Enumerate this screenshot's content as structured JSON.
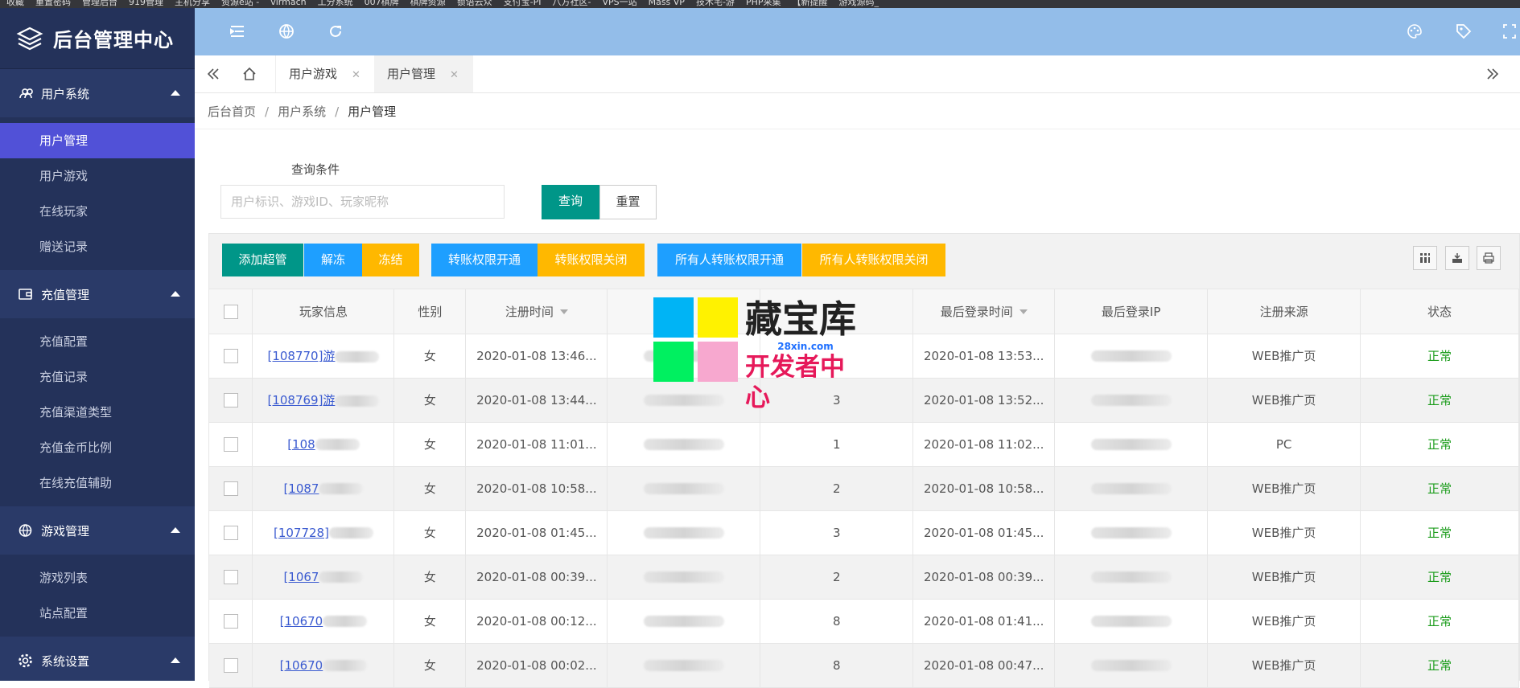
{
  "bookmarks": [
    "收藏",
    "重置密码",
    "管理后台",
    "919管理",
    "主机分享",
    "资源e站 -",
    "virmach",
    "工分系统",
    "007棋牌",
    "棋牌资源",
    "锁语云众",
    "支付宝-PI",
    "八方社区-",
    "VPS一站",
    "Mass VP",
    "技术宅-游",
    "PHP采集",
    "【新提醒",
    "游戏源码_"
  ],
  "sidebar": {
    "title": "后台管理中心",
    "groups": [
      {
        "label": "用户系统",
        "icon": "users-icon",
        "items": [
          "用户管理",
          "用户游戏",
          "在线玩家",
          "赠送记录"
        ]
      },
      {
        "label": "充值管理",
        "icon": "wallet-icon",
        "items": [
          "充值配置",
          "充值记录",
          "充值渠道类型",
          "充值金币比例",
          "在线充值辅助"
        ]
      },
      {
        "label": "游戏管理",
        "icon": "globe-icon",
        "items": [
          "游戏列表",
          "站点配置"
        ]
      },
      {
        "label": "系统设置",
        "icon": "gear-icon",
        "items": []
      }
    ],
    "active": "用户管理"
  },
  "tabs": {
    "items": [
      {
        "label": "用户游戏"
      },
      {
        "label": "用户管理"
      }
    ],
    "active": "用户管理"
  },
  "breadcrumb": {
    "items": [
      "后台首页",
      "用户系统",
      "用户管理"
    ]
  },
  "query": {
    "label": "查询条件",
    "placeholder": "用户标识、游戏ID、玩家昵称",
    "search_label": "查询",
    "reset_label": "重置"
  },
  "toolbar": {
    "buttons": [
      "添加超管",
      "解冻",
      "冻结",
      "转账权限开通",
      "转账权限关闭",
      "所有人转账权限开通",
      "所有人转账权限关闭"
    ]
  },
  "table": {
    "headers": [
      "玩家信息",
      "性别",
      "注册时间",
      "",
      "",
      "最后登录时间",
      "最后登录IP",
      "注册来源",
      "状态"
    ],
    "rows": [
      {
        "player": "[108770]游",
        "gender": "女",
        "reg": "2020-01-08 13:46...",
        "col4": "",
        "count": "",
        "last": "2020-01-08 13:53...",
        "ip": "",
        "source": "WEB推广页",
        "status": "正常"
      },
      {
        "player": "[108769]游",
        "gender": "女",
        "reg": "2020-01-08 13:44...",
        "col4": "",
        "count": "3",
        "last": "2020-01-08 13:52...",
        "ip": "",
        "source": "WEB推广页",
        "status": "正常"
      },
      {
        "player": "[108",
        "gender": "女",
        "reg": "2020-01-08 11:01...",
        "col4": "",
        "count": "1",
        "last": "2020-01-08 11:02...",
        "ip": "",
        "source": "PC",
        "status": "正常"
      },
      {
        "player": "[1087",
        "gender": "女",
        "reg": "2020-01-08 10:58...",
        "col4": "",
        "count": "2",
        "last": "2020-01-08 10:58...",
        "ip": "",
        "source": "WEB推广页",
        "status": "正常"
      },
      {
        "player": "[107728]",
        "gender": "女",
        "reg": "2020-01-08 01:45...",
        "col4": "",
        "count": "3",
        "last": "2020-01-08 01:45...",
        "ip": "",
        "source": "WEB推广页",
        "status": "正常"
      },
      {
        "player": "[1067",
        "gender": "女",
        "reg": "2020-01-08 00:39...",
        "col4": "",
        "count": "2",
        "last": "2020-01-08 00:39...",
        "ip": "",
        "source": "WEB推广页",
        "status": "正常"
      },
      {
        "player": "[10670",
        "gender": "女",
        "reg": "2020-01-08 00:12...",
        "col4": "",
        "count": "8",
        "last": "2020-01-08 01:41...",
        "ip": "",
        "source": "WEB推广页",
        "status": "正常"
      },
      {
        "player": "[10670",
        "gender": "女",
        "reg": "2020-01-08 00:02...",
        "col4": "",
        "count": "8",
        "last": "2020-01-08 00:47...",
        "ip": "",
        "source": "WEB推广页",
        "status": "正常"
      }
    ]
  },
  "watermark": {
    "title": "藏宝库",
    "url": "28xin.com",
    "subtitle": "开发者中心"
  },
  "colors": {
    "sidebar": "#24325a",
    "active": "#5151d7",
    "topbar": "#93bde9",
    "green": "#009688",
    "blue": "#1e9fff",
    "orange": "#ffb800"
  }
}
